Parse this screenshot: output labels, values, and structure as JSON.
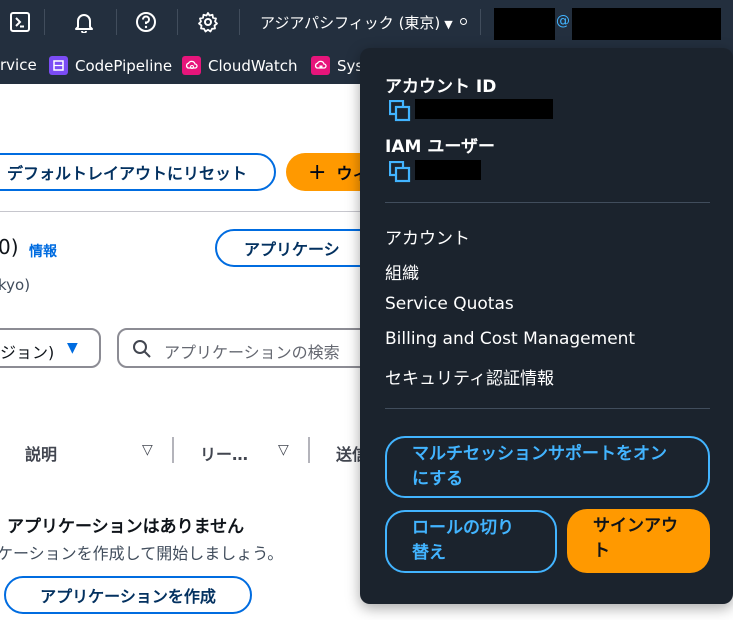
{
  "topnav": {
    "region_label": "アジアパシフィック (東京)",
    "at_sign": "@",
    "icons": [
      "cloudshell-icon",
      "bell-icon",
      "help-icon",
      "gear-icon"
    ]
  },
  "favorites": [
    {
      "label": "rvice",
      "icon": "service-icon",
      "color": "#232f3e"
    },
    {
      "label": "CodePipeline",
      "icon": "codepipeline-icon",
      "color": "#7b4cf5"
    },
    {
      "label": "CloudWatch",
      "icon": "cloudwatch-icon",
      "color": "#e7157b"
    },
    {
      "label": "Sys",
      "icon": "systems-manager-icon",
      "color": "#e7157b"
    }
  ],
  "main": {
    "reset_layout_label": "デフォルトレイアウトにリセット",
    "add_widget_label": "ウィ",
    "count_fragment": "0)",
    "info_link": "情報",
    "create_app_top_label": "アプリケーシ",
    "region_fragment": "kyo)",
    "filter_select_value": "ジョン)",
    "search_placeholder": "アプリケーションの検索",
    "col_description": "説明",
    "col_region": "リー…",
    "col_send": "送信",
    "empty_title": "アプリケーションはありません",
    "empty_desc": "ケーションを作成して開始しましょう。",
    "create_app_label": "アプリケーションを作成"
  },
  "account_menu": {
    "account_id_label": "アカウント ID",
    "iam_user_label": "IAM ユーザー",
    "items": [
      "アカウント",
      "組織",
      "Service Quotas",
      "Billing and Cost Management",
      "セキュリティ認証情報"
    ],
    "multi_session_line1": "マルチセッションサポートをオン",
    "multi_session_line2": "にする",
    "switch_role_line1": "ロールの切り",
    "switch_role_line2": "替え",
    "sign_out_line1": "サインアウ",
    "sign_out_line2": "ト"
  },
  "colors": {
    "nav_bg": "#232f3e",
    "panel_bg": "#1b232d",
    "accent_blue": "#42b4ff",
    "link_blue": "#006ce0",
    "orange": "#ff9900"
  }
}
